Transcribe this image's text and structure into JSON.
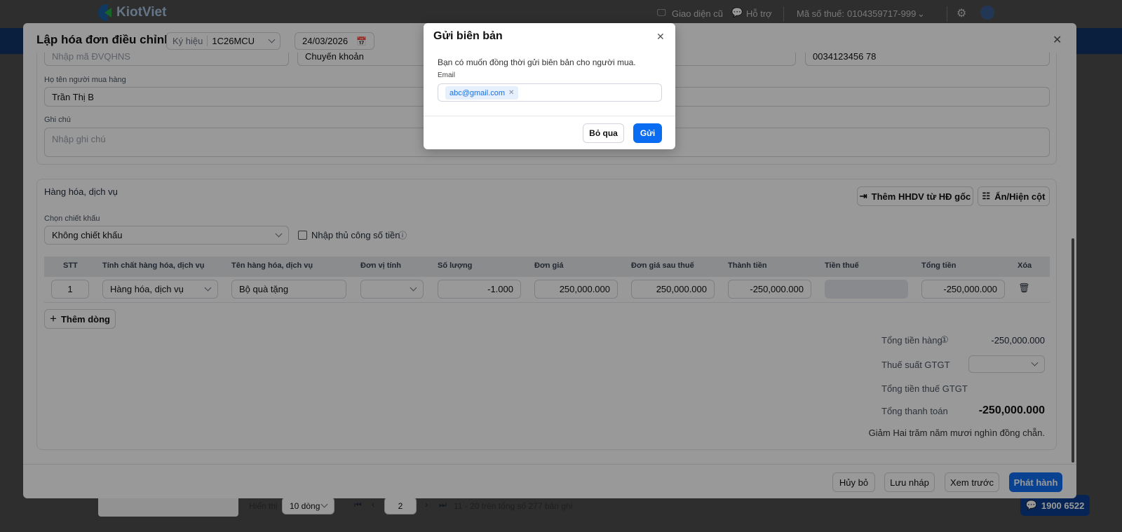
{
  "topbar": {
    "logo_text": "KiotViet",
    "old_ui": "Giao diện cũ",
    "support": "Hỗ trợ",
    "tax_label": "Mã số thuế:",
    "tax_value": "0104359717-999"
  },
  "modal": {
    "title": "Lập hóa đơn điều chỉnh",
    "symbol_label": "Ký hiệu",
    "symbol_value": "1C26MCU",
    "date": "24/03/2026",
    "top_row": {
      "budget_code_placeholder": "Nhập mã ĐVQHNS",
      "payment_method": "Chuyển khoản",
      "phone": "0034123456 78"
    },
    "buyer_name_label": "Họ tên người mua hàng",
    "buyer_name": "Trần Thị B",
    "note_label": "Ghi chú",
    "note_placeholder": "Nhập ghi chú",
    "goods": {
      "title": "Hàng hóa, dịch vụ",
      "add_from_original": "Thêm HHDV từ HĐ gốc",
      "toggle_columns": "Ẩn/Hiện cột",
      "discount_label": "Chọn chiết khấu",
      "discount_value": "Không chiết khấu",
      "manual_amount": "Nhập thủ công số tiền",
      "columns": [
        "STT",
        "Tính chất hàng hóa, dịch vụ",
        "Tên hàng hóa, dịch vụ",
        "Đơn vị tính",
        "Số lượng",
        "Đơn giá",
        "Đơn giá sau thuế",
        "Thành tiền",
        "Tiền thuế",
        "Tổng tiền",
        "Xóa"
      ],
      "rows": [
        {
          "stt": "1",
          "type": "Hàng hóa, dịch vụ",
          "name": "Bộ quà tặng",
          "unit": "",
          "qty": "-1.000",
          "price": "250,000.000",
          "price_after_tax": "250,000.000",
          "amount": "-250,000.000",
          "tax": "",
          "total": "-250,000.000"
        }
      ],
      "add_row": "Thêm dòng"
    },
    "totals": {
      "goods_total_label": "Tổng tiền hàng",
      "goods_total": "-250,000.000",
      "vat_rate_label": "Thuế suất GTGT",
      "vat_total_label": "Tổng tiền thuế GTGT",
      "payment_total_label": "Tổng thanh toán",
      "payment_total": "-250,000.000",
      "in_words": "Giảm Hai trăm năm mươi nghìn đồng chẵn."
    },
    "footer": {
      "cancel": "Hủy bỏ",
      "save_draft": "Lưu nháp",
      "preview": "Xem trước",
      "issue": "Phát hành"
    }
  },
  "pagination": {
    "show_label": "Hiển thị",
    "page_size": "10 dòng",
    "page": "2",
    "summary": "11 - 20 trên tổng số 277 bản ghi"
  },
  "hotline": "1900 6522",
  "dialog": {
    "title": "Gửi biên bản",
    "message": "Bạn có muốn đồng thời gửi biên bản cho người mua.",
    "email_label": "Email",
    "emails": [
      "abc@gmail.com"
    ],
    "skip": "Bỏ qua",
    "send": "Gửi"
  },
  "colors": {
    "primary": "#0a6cf0",
    "navy": "#113366"
  }
}
